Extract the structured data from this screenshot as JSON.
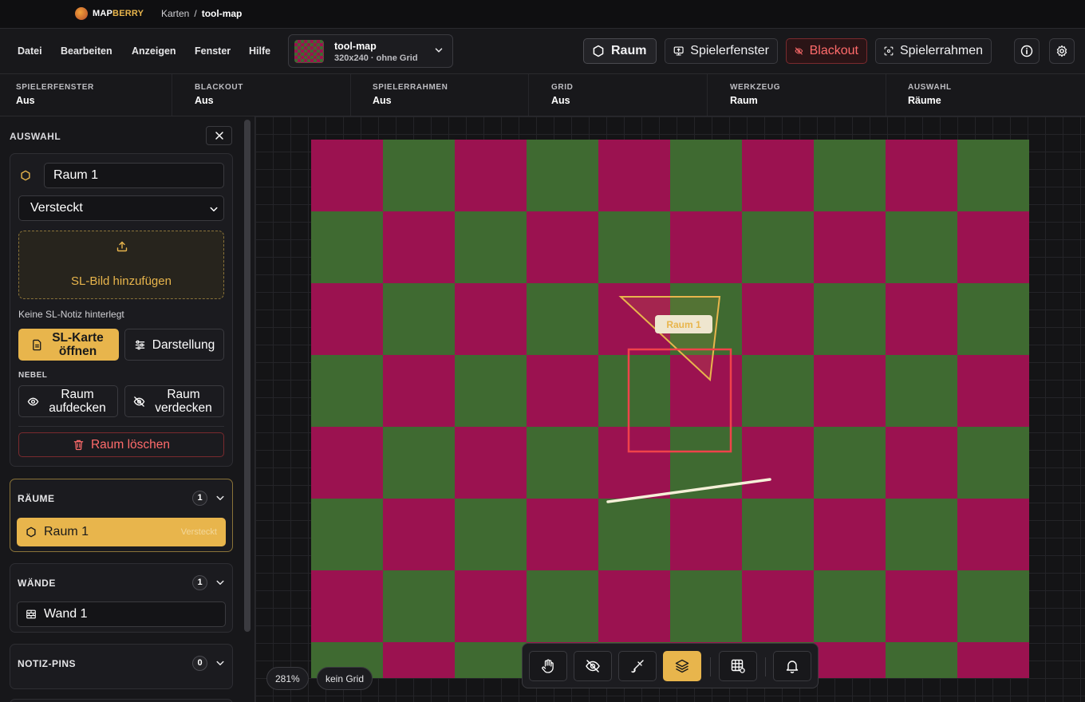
{
  "app": {
    "brand_part1": "MAP",
    "brand_part2": "BERRY"
  },
  "breadcrumb": {
    "parent": "Karten",
    "separator": "/",
    "current": "tool-map"
  },
  "menu": {
    "items": [
      "Datei",
      "Bearbeiten",
      "Anzeigen",
      "Fenster",
      "Hilfe"
    ]
  },
  "map_selector": {
    "name": "tool-map",
    "meta": "320x240 · ohne Grid"
  },
  "toolbar_top": {
    "raum": "Raum",
    "spielerfenster": "Spielerfenster",
    "blackout": "Blackout",
    "spielerrahmen": "Spielerrahmen"
  },
  "status": [
    {
      "key": "SPIELERFENSTER",
      "value": "Aus"
    },
    {
      "key": "BLACKOUT",
      "value": "Aus"
    },
    {
      "key": "SPIELERRAHMEN",
      "value": "Aus"
    },
    {
      "key": "GRID",
      "value": "Aus"
    },
    {
      "key": "WERKZEUG",
      "value": "Raum"
    },
    {
      "key": "AUSWAHL",
      "value": "Räume"
    }
  ],
  "selection": {
    "title": "AUSWAHL",
    "name": "Raum 1",
    "visibility": "Versteckt",
    "upload_label": "SL-Bild hinzufügen",
    "note": "Keine SL-Notiz hinterlegt",
    "open_card": "SL-Karte öffnen",
    "display": "Darstellung",
    "fog_label": "NEBEL",
    "reveal": "Raum aufdecken",
    "hide": "Raum verdecken",
    "delete": "Raum löschen"
  },
  "sections": {
    "rooms": {
      "title": "RÄUME",
      "count": "1",
      "items": [
        {
          "label": "Raum 1",
          "tag": "Versteckt"
        }
      ]
    },
    "walls": {
      "title": "WÄNDE",
      "count": "1",
      "items": [
        {
          "label": "Wand 1"
        }
      ]
    },
    "pins": {
      "title": "NOTIZ-PINS",
      "count": "0"
    }
  },
  "map_overlay": {
    "room_label": "Raum 1"
  },
  "bottom": {
    "zoom": "281%",
    "grid": "kein Grid"
  },
  "colors": {
    "accent": "#e8b54c",
    "danger": "#ff6b6b",
    "map_magenta": "#9b1250",
    "map_green": "#3f6a31"
  },
  "icons": [
    "hand-icon",
    "eye-off-icon",
    "brush-icon",
    "layers-icon",
    "grid-icon",
    "bell-icon"
  ]
}
